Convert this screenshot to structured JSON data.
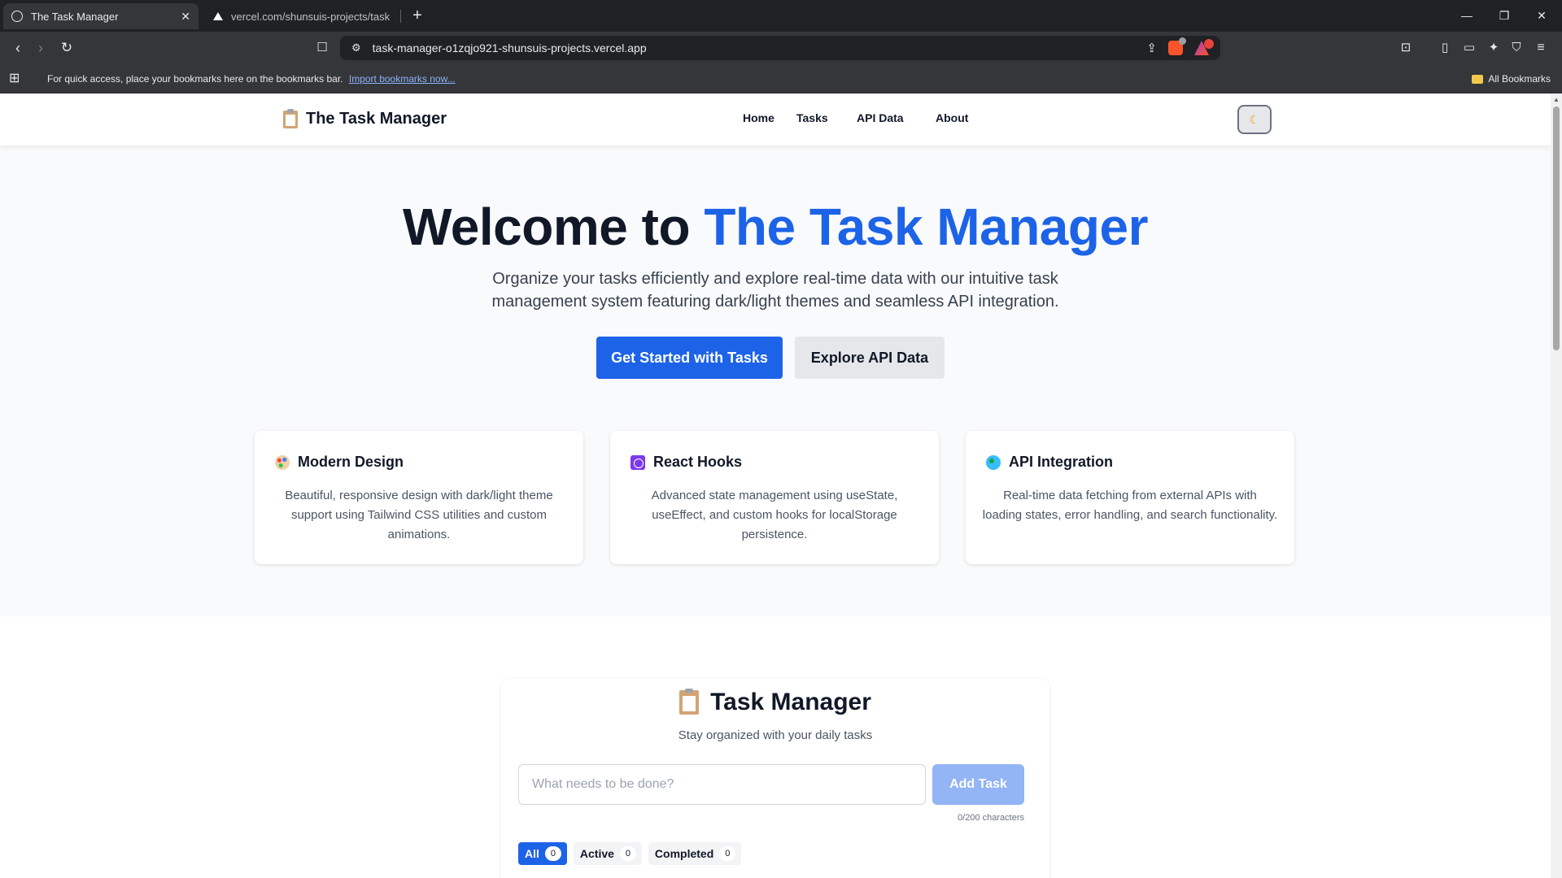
{
  "browser": {
    "tabs": [
      {
        "title": "The Task Manager",
        "active": true
      },
      {
        "title": "vercel.com/shunsuis-projects/task-m",
        "active": false
      }
    ],
    "url": "task-manager-o1zqjo921-shunsuis-projects.vercel.app",
    "bookmarks_bar": {
      "message": "For quick access, place your bookmarks here on the bookmarks bar.",
      "import_link": "Import bookmarks now...",
      "all_bookmarks": "All Bookmarks"
    }
  },
  "navbar": {
    "brand": "The Task Manager",
    "links": [
      "Home",
      "Tasks",
      "API Data",
      "About"
    ],
    "theme_toggle_icon": "moon-icon"
  },
  "hero": {
    "title_prefix": "Welcome to ",
    "title_accent": "The Task Manager",
    "subtitle": "Organize your tasks efficiently and explore real-time data with our intuitive task management system featuring dark/light themes and seamless API integration.",
    "primary_button": "Get Started with Tasks",
    "secondary_button": "Explore API Data",
    "accent_color": "#1d63e8"
  },
  "features": [
    {
      "icon": "palette-icon",
      "title": "Modern Design",
      "text": "Beautiful, responsive design with dark/light theme support using Tailwind CSS utilities and custom animations."
    },
    {
      "icon": "atom-icon",
      "title": "React Hooks",
      "text": "Advanced state management using useState, useEffect, and custom hooks for localStorage persistence."
    },
    {
      "icon": "globe-icon",
      "title": "API Integration",
      "text": "Real-time data fetching from external APIs with loading states, error handling, and search functionality."
    }
  ],
  "task_manager": {
    "title": "Task Manager",
    "subtitle": "Stay organized with your daily tasks",
    "input_placeholder": "What needs to be done?",
    "input_value": "",
    "add_button": "Add Task",
    "char_count": "0/200 characters",
    "filters": [
      {
        "label": "All",
        "count": "0",
        "selected": true
      },
      {
        "label": "Active",
        "count": "0",
        "selected": false
      },
      {
        "label": "Completed",
        "count": "0",
        "selected": false
      }
    ]
  }
}
